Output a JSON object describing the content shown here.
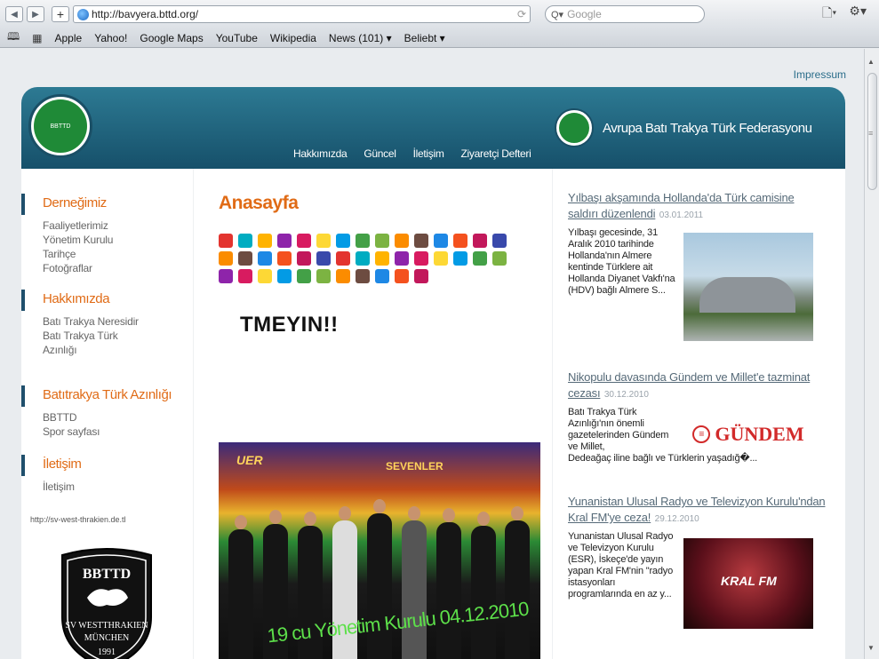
{
  "browser": {
    "back_glyph": "◀",
    "forward_glyph": "▶",
    "plus_glyph": "+",
    "url": "http://bavyera.bttd.org/",
    "snap_glyph": "⟳",
    "search_prefix": "Q▾",
    "search_placeholder": "Google",
    "page_menu_glyph": "🗋▾",
    "gear_glyph": "⚙▾"
  },
  "bookmarks": {
    "book_glyph": "🕮",
    "grid_glyph": "▦",
    "items": [
      "Apple",
      "Yahoo!",
      "Google Maps",
      "YouTube",
      "Wikipedia",
      "News (101) ▾",
      "Beliebt ▾"
    ]
  },
  "scrollbar": {
    "up": "▲",
    "down": "▼",
    "grip": "≡"
  },
  "site": {
    "impressum": "Impressum",
    "federation": "Avrupa Batı Trakya Türk Federasyonu",
    "logo_text": "BBTTD",
    "nav": [
      "Hakkımızda",
      "Güncel",
      "İletişim",
      "Ziyaretçi Defteri"
    ]
  },
  "sidebar": {
    "sections": [
      {
        "title": "Derneğimiz",
        "items": [
          "Faaliyetlerimiz",
          "Yönetim Kurulu",
          "Tarihçe",
          "Fotoğraflar"
        ]
      },
      {
        "title": "Hakkımızda",
        "items": [
          "Batı Trakya Neresidir",
          "Batı Trakya Türk",
          "Azınlığı"
        ]
      },
      {
        "title": "Batıtrakya Türk Azınlığı",
        "items": [
          "BBTTD",
          "Spor sayfası"
        ]
      },
      {
        "title": "İletişim",
        "items": [
          "İletişim"
        ]
      }
    ],
    "ext_link": "http://sv-west-thrakien.de.tl",
    "badge_top": "BBTTD",
    "badge_line1": "SV WESTTHRAKIEN",
    "badge_line2": "MÜNCHEN",
    "badge_year": "1991"
  },
  "main": {
    "title": "Anasayfa",
    "banner": "TMEYIN!!",
    "photo_sign1": "UER",
    "photo_sign2": "SEVENLER",
    "photo_caption": "19 cu Yönetim Kurulu 04.12.2010"
  },
  "news": [
    {
      "title": "Yılbaşı akşamında Hollanda'da Türk camisine saldırı düzenlendi",
      "date": "03.01.2011",
      "body": "Yılbaşı gecesinde, 31 Aralık 2010 tarihinde Hollanda'nın Almere kentinde Türklere ait Hollanda Diyanet Vakfı'na (HDV) bağlı Almere S..."
    },
    {
      "title": "Nikopulu davasında Gündem ve Millet'e tazminat cezası",
      "date": "30.12.2010",
      "body": "Batı Trakya Türk Azınlığı'nın önemli gazetelerinden Gündem ve Millet,",
      "body_tail": "Dedeağaç iline bağlı ve Türklerin yaşadığ�...",
      "logo": "GÜNDEM"
    },
    {
      "title": "Yunanistan Ulusal Radyo ve Televizyon Kurulu'ndan Kral FM'ye ceza!",
      "date": "29.12.2010",
      "body": "Yunanistan Ulusal Radyo ve Televizyon Kurulu (ESR), İskeçe'de yayın yapan Kral FM'nin \"radyo istasyonları programlarında en az y...",
      "logo": "KRAL FM"
    }
  ],
  "icon_colors": [
    "#e3342f",
    "#c2185b",
    "#1e88e5",
    "#fb8c00",
    "#43a047",
    "#fdd835",
    "#8e24aa",
    "#00acc1",
    "#3949ab",
    "#f4511e",
    "#6d4c41",
    "#7cb342",
    "#039be5",
    "#d81b60",
    "#ffb300"
  ]
}
